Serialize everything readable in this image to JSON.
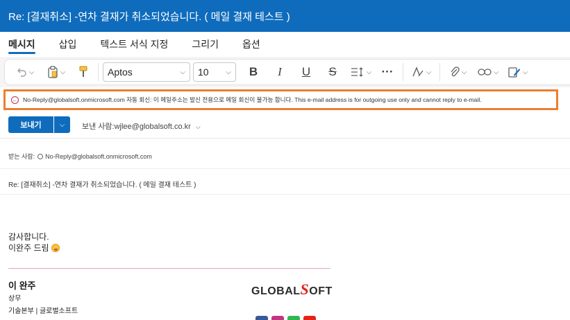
{
  "window": {
    "title": "Re: [결재취소] -연차 결재가 취소되었습니다. ( 메일 결재 테스트 )"
  },
  "ribbon": {
    "tabs": [
      "메시지",
      "삽입",
      "텍스트 서식 지정",
      "그리기",
      "옵션"
    ],
    "active_tab": "메시지"
  },
  "toolbar": {
    "font_name": "Aptos",
    "font_size": "10"
  },
  "warning": {
    "text": "No-Reply@globalsoft.onmicrosoft.com 자동 회신: 이 메일주소는 발신 전용으로 메일 회신이 불가능 합니다. This e-mail address is for outgoing use only and cannot reply to e-mail."
  },
  "compose": {
    "send_label": "보내기",
    "from_label": "보낸 사람:",
    "from_value": "wjlee@globalsoft.co.kr",
    "to_label": "받는 사람:",
    "to_value": "No-Reply@globalsoft.onmicrosoft.com",
    "subject": "Re: [결재취소] -연차 결재가 취소되었습니다. ( 메일 결재 테스트 )"
  },
  "body": {
    "line1": "감사합니다.",
    "line2": "이완주 드림"
  },
  "signature": {
    "name": "이 완주",
    "title": "상무",
    "dept": "기술본부 | 글로벌소프트",
    "logo_prefix": "GLOBAL",
    "logo_s": "S",
    "logo_suffix": "OFT"
  },
  "colors": {
    "brand": "#0f6cbd",
    "warning_border": "#ec7f2e",
    "signature_line": "#e9a0b6",
    "logo_accent": "#e2231a"
  }
}
